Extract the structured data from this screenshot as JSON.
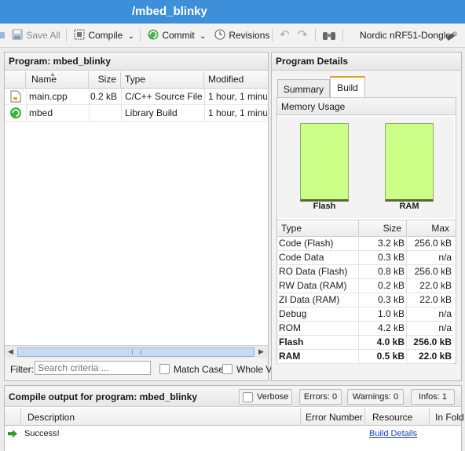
{
  "window": {
    "title": "/mbed_blinky"
  },
  "toolbar": {
    "save_all": "Save All",
    "compile": "Compile",
    "commit": "Commit",
    "revisions": "Revisions",
    "target": "Nordic nRF51-Dongle"
  },
  "program": {
    "header": "Program: mbed_blinky",
    "columns": [
      "Name",
      "Size",
      "Type",
      "Modified"
    ],
    "files": [
      {
        "name": "main.cpp",
        "size": "0.2 kB",
        "type": "C/C++ Source File",
        "modified": "1 hour, 1 minut",
        "icon": "file-icon"
      },
      {
        "name": "mbed",
        "size": "",
        "type": "Library Build",
        "modified": "1 hour, 1 minut",
        "icon": "library-icon"
      }
    ],
    "filter_label": "Filter:",
    "filter_placeholder": "Search criteria ...",
    "match_case": "Match Case",
    "whole_word": "Whole V"
  },
  "details": {
    "header": "Program Details",
    "tabs": [
      "Summary",
      "Build"
    ],
    "active_tab": "Build",
    "memory_usage": "Memory Usage",
    "bars": [
      {
        "label": "Flash",
        "used_fraction": 0.0156
      },
      {
        "label": "RAM",
        "used_fraction": 0.0227
      }
    ],
    "table_head": {
      "type": "Type",
      "size": "Size",
      "max": "Max"
    },
    "rows": [
      {
        "type": "Code (Flash)",
        "size": "3.2 kB",
        "max": "256.0 kB",
        "bold": false
      },
      {
        "type": "Code Data",
        "size": "0.3 kB",
        "max": "n/a",
        "bold": false
      },
      {
        "type": "RO Data (Flash)",
        "size": "0.8 kB",
        "max": "256.0 kB",
        "bold": false
      },
      {
        "type": "RW Data (RAM)",
        "size": "0.2 kB",
        "max": "22.0 kB",
        "bold": false
      },
      {
        "type": "ZI Data (RAM)",
        "size": "0.3 kB",
        "max": "22.0 kB",
        "bold": false
      },
      {
        "type": "Debug",
        "size": "1.0 kB",
        "max": "n/a",
        "bold": false
      },
      {
        "type": "ROM",
        "size": "4.2 kB",
        "max": "n/a",
        "bold": false
      },
      {
        "type": "Flash",
        "size": "4.0 kB",
        "max": "256.0 kB",
        "bold": true
      },
      {
        "type": "RAM",
        "size": "0.5 kB",
        "max": "22.0 kB",
        "bold": true
      }
    ],
    "bar_color": "#ccff88"
  },
  "compile": {
    "header": "Compile output for program: mbed_blinky",
    "verbose": "Verbose",
    "errors": "Errors: 0",
    "warnings": "Warnings: 0",
    "infos": "Infos: 1",
    "columns": [
      "Description",
      "Error Number",
      "Resource",
      "In Fold"
    ],
    "message": "Success!",
    "build_details": "Build Details"
  },
  "colors": {
    "title_bar": "#3d8fd9",
    "success_arrow": "#2a9a2a",
    "link": "#1a3fd0"
  }
}
